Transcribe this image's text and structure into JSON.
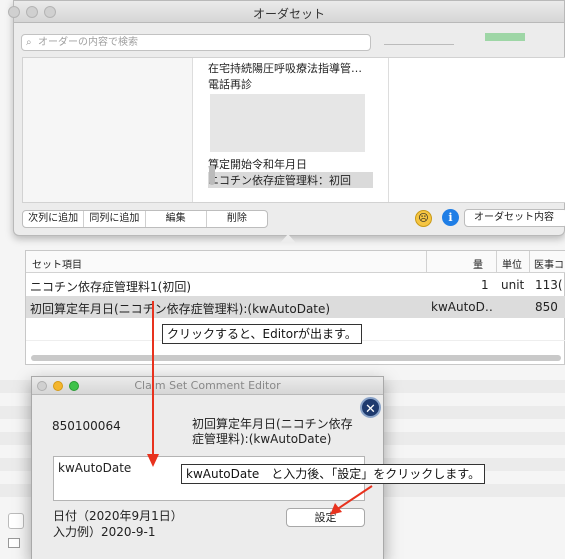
{
  "order_set_window": {
    "title": "オーダセット",
    "search_placeholder": "オーダーの内容で検索",
    "list_items": [
      "在宅持続陽圧呼吸療法指導管…",
      "電話再診",
      "算定開始令和年月日",
      "ニコチン依存症管理料：初回"
    ],
    "buttons": [
      "次列に追加",
      "同列に追加",
      "編集",
      "削除"
    ],
    "content_button": "オーダセット内容"
  },
  "set_table": {
    "headers": [
      "セット項目",
      "量",
      "単位",
      "医事コ"
    ],
    "rows": [
      [
        "ニコチン依存症管理料1(初回)",
        "1",
        "unit",
        "113("
      ],
      [
        "初回算定年月日(ニコチン依存症管理料):(kwAutoDate)",
        "kwAutoD…",
        "",
        "850"
      ]
    ]
  },
  "annotations": {
    "click_note": "クリックすると、Editorが出ます。",
    "input_note": "kwAutoDate　と入力後、「設定」をクリックします。"
  },
  "editor": {
    "title": "Claim Set Comment Editor",
    "code": "850100064",
    "item_name": "初回算定年月日(ニコチン依存症管理料):(kwAutoDate)",
    "input_value": "kwAutoDate",
    "hint_date": "日付（2020年9月1日）",
    "hint_example": "入力例）2020-9-1",
    "set_button": "設定"
  },
  "colors": {
    "arrow": "#e8321e",
    "info": "#1f7ee6",
    "selected_row": "#dcdcdc"
  }
}
